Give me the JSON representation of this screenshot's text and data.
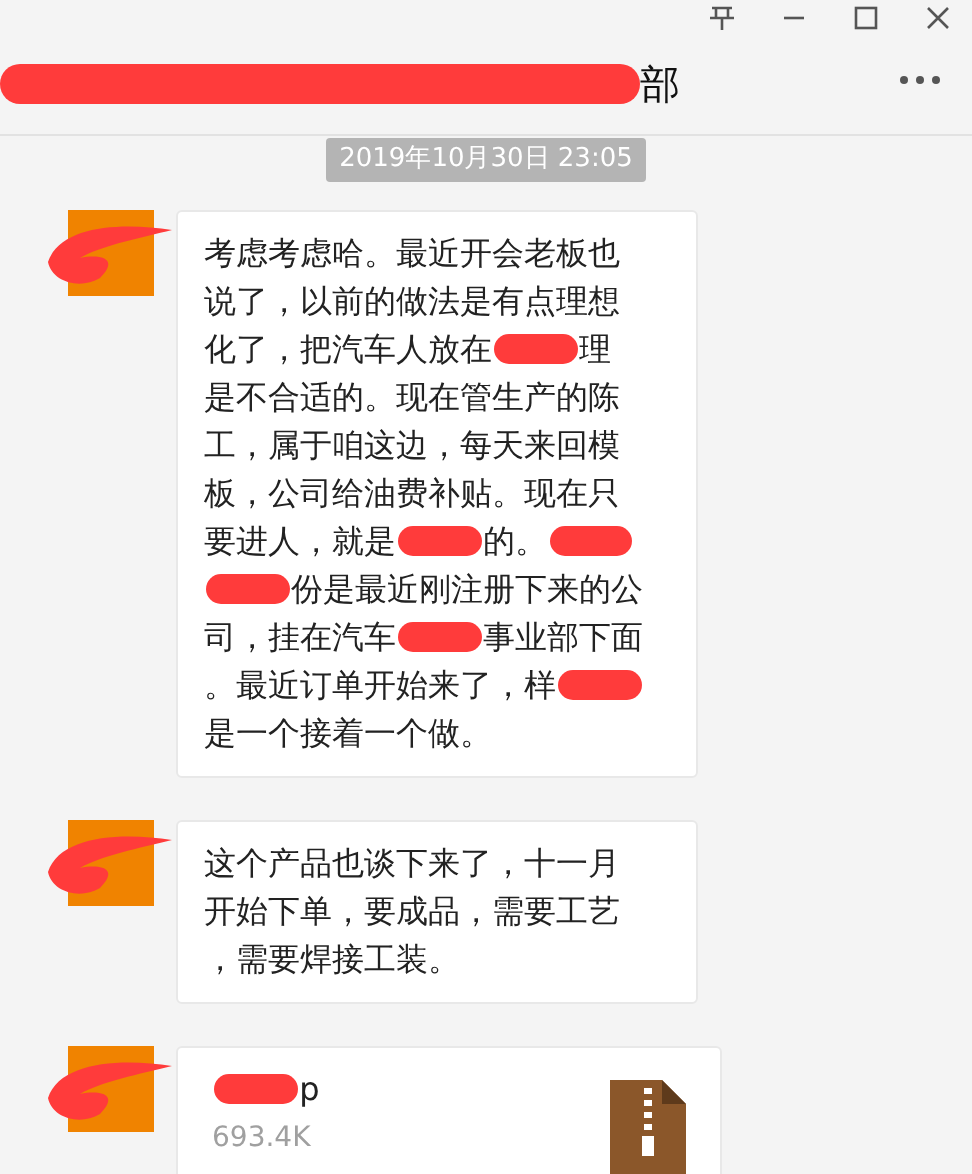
{
  "window": {
    "title_parts": [
      {
        "kind": "redacted"
      },
      {
        "kind": "text",
        "text": "部"
      }
    ]
  },
  "timestamp": "2019年10月30日 23:05",
  "messages": [
    {
      "kind": "text",
      "lines": [
        [
          {
            "kind": "text",
            "text": "考虑考虑哈。最近开会老板也"
          }
        ],
        [
          {
            "kind": "text",
            "text": "说了，以前的做法是有点理想"
          }
        ],
        [
          {
            "kind": "text",
            "text": "化了，把汽车人放在"
          },
          {
            "kind": "redacted"
          },
          {
            "kind": "text",
            "text": "理"
          }
        ],
        [
          {
            "kind": "text",
            "text": "是不合适的。现在管生产的陈"
          }
        ],
        [
          {
            "kind": "text",
            "text": "工，属于咱这边，每天来回模"
          }
        ],
        [
          {
            "kind": "text",
            "text": "板，公司给油费补贴。现在只"
          }
        ],
        [
          {
            "kind": "text",
            "text": "要进人，就是"
          },
          {
            "kind": "redacted"
          },
          {
            "kind": "text",
            "text": "的。"
          },
          {
            "kind": "redacted"
          }
        ],
        [
          {
            "kind": "redacted"
          },
          {
            "kind": "text",
            "text": "份是最近刚注册下来的公"
          }
        ],
        [
          {
            "kind": "text",
            "text": "司，挂在汽车"
          },
          {
            "kind": "redacted"
          },
          {
            "kind": "text",
            "text": "事业部下面"
          }
        ],
        [
          {
            "kind": "text",
            "text": "。最近订单开始来了，样"
          },
          {
            "kind": "redacted"
          }
        ],
        [
          {
            "kind": "text",
            "text": "是一个接着一个做。"
          }
        ]
      ]
    },
    {
      "kind": "text",
      "lines": [
        [
          {
            "kind": "text",
            "text": "这个产品也谈下来了，十一月"
          }
        ],
        [
          {
            "kind": "text",
            "text": "开始下单，要成品，需要工艺"
          }
        ],
        [
          {
            "kind": "text",
            "text": "，需要焊接工装。"
          }
        ]
      ]
    },
    {
      "kind": "file",
      "name_parts": [
        {
          "kind": "redacted"
        },
        {
          "kind": "text",
          "text": "p"
        }
      ],
      "size": "693.4K"
    }
  ]
}
